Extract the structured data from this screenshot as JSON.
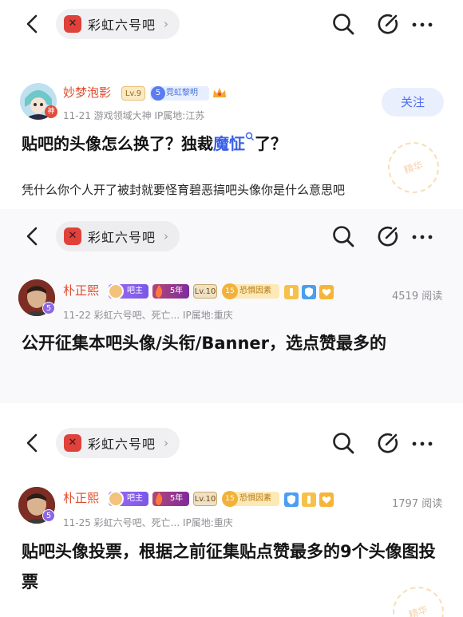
{
  "topbar": {
    "forum_name": "彩虹六号吧",
    "chevron": "›"
  },
  "post1": {
    "username": "妙梦泡影",
    "level": "Lv.9",
    "tag_num": "5",
    "tag_text": "霓虹黎明",
    "avatar_corner": "神",
    "meta": "11-21   游戏领域大神  IP属地:江苏",
    "follow_label": "关注",
    "title_before": "贴吧的头像怎么换了？独裁",
    "title_keyword": "魔怔",
    "title_after": "了？",
    "body": "凭什么你个人开了被封就要怪育碧恶搞吧头像你是什么意思吧",
    "stamp_text": "精华"
  },
  "post2": {
    "username": "朴正熙",
    "role": "吧主",
    "years": "5年",
    "level": "Lv.10",
    "tag_num": "15",
    "tag_text": "恐惧因素",
    "avatar_num": "5",
    "meta": "11-22   彩虹六号吧、死亡...  IP属地:重庆",
    "views": "4519 阅读",
    "title": "公开征集本吧头像/头衔/Banner，选点赞最多的"
  },
  "post3": {
    "username": "朴正熙",
    "role": "吧主",
    "years": "5年",
    "level": "Lv.10",
    "tag_num": "15",
    "tag_text": "恐惧因素",
    "avatar_num": "5",
    "meta": "11-25   彩虹六号吧、死亡...  IP属地:重庆",
    "views": "1797 阅读",
    "title": "贴吧头像投票，根据之前征集贴点赞最多的9个头像图投票",
    "stamp_text": "精华"
  },
  "icons": [
    "back-arrow-icon",
    "forum-logo-icon",
    "search-icon",
    "edit-icon",
    "more-icon",
    "fire-icon",
    "shield-icon",
    "heart-icon"
  ],
  "colors": {
    "accent": "#4e6ef2",
    "username": "#e04a2a",
    "forum_logo": "#e0413a"
  }
}
